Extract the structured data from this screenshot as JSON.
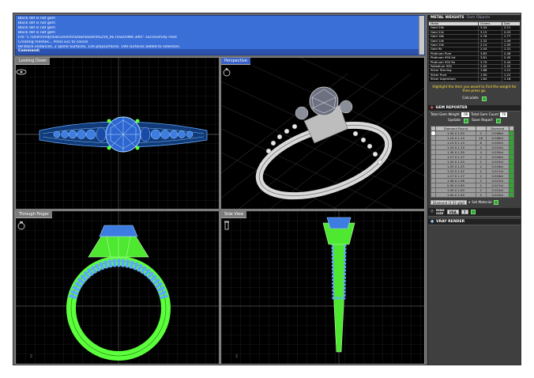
{
  "command_window": {
    "lines": [
      "Block def is not gem",
      "Block def is not gem",
      "Block def is not gem",
      "Block def is not gem",
      "File \"C:\\Users\\mdjr\\Documents\\Downloads\\RS254_RETSSD1989.3dm\" successfully read",
      "Creating meshes... Press Esc to cancel",
      "69 block instances, 2 spline Surfaces, 126 polysurfaces. 190 surfaces added to selection."
    ],
    "prompt": "Command:"
  },
  "viewports": {
    "top": "Looking Down",
    "perspective": "Perspective",
    "front": "Through Finger",
    "side": "Side View"
  },
  "metal_weights": {
    "title": "METAL WEIGHTS",
    "tab2": "Gem Objects",
    "headers": [
      "Metal",
      "Grams",
      "Dwt"
    ],
    "rows": [
      [
        "Gold 24k",
        "3.44",
        "2.21"
      ],
      [
        "Gold 22k",
        "3.15",
        "2.03"
      ],
      [
        "Gold 18k",
        "2.76",
        "1.77"
      ],
      [
        "Gold 14k",
        "2.32",
        "1.49"
      ],
      [
        "Gold 10k",
        "2.10",
        "1.35"
      ],
      [
        "Gold 9k",
        "2.04",
        "1.31"
      ],
      [
        "Platinum Pure",
        "3.83",
        "2.46"
      ],
      [
        "Platinum 950 Ird",
        "3.81",
        "2.45"
      ],
      [
        "Platinum 950 Ru",
        "3.79",
        "2.44"
      ],
      [
        "Palladium 950",
        "2.05",
        "1.32"
      ],
      [
        "Silver Sterling",
        "1.88",
        "1.21"
      ],
      [
        "Silver Pure",
        "1.90",
        "1.22"
      ],
      [
        "Silver Argentium",
        "1.84",
        "1.18"
      ]
    ],
    "hint": "Highlight the item you would to find the weight for then press go.",
    "calculate_label": "Calculate"
  },
  "gem_reporter": {
    "title": "GEM REPORTER",
    "total_weight_label": "Total Gem Weight",
    "total_weight_value": ".00",
    "total_count_label": "Total Gem Count",
    "total_count_value": "70",
    "update_label": "Update",
    "save_report_label": "Save Report",
    "headers": [
      "Diamond Round",
      "",
      "Diamond"
    ],
    "rows": [
      [
        "1.00 X 1.00",
        "2",
        "0.008ct"
      ],
      [
        "1.10 X 1.10",
        "16",
        "0.006ct"
      ],
      [
        "1.13 X 1.13",
        "6",
        "0.020ct"
      ],
      [
        "1.19 X 1.19",
        "4",
        "0.010ct"
      ],
      [
        "1.30 X 1.30",
        "4",
        "0.030ct"
      ],
      [
        "1.17 X 1.17",
        "2",
        "0.018ct"
      ],
      [
        "1.20 X 1.20",
        "2",
        "0.015ct"
      ],
      [
        "1.25 X 1.25",
        "2",
        "0.016ct"
      ],
      [
        "1.22 X 1.22",
        "2",
        "0.017ct"
      ],
      [
        "1.17 X 1.17",
        "2",
        "0.016ct"
      ],
      [
        "1.08 X 1.08",
        "2",
        "0.013ct"
      ],
      [
        "0.95 X 0.95",
        "2",
        "0.017ct"
      ],
      [
        "1.00 X 1.00",
        "2",
        "0.015ct"
      ],
      [
        "1.00 X 1.00",
        "2",
        "0.015ct"
      ]
    ],
    "diamond_select": "Diamond (3.52 g/gl)",
    "set_material_label": "Set Material"
  },
  "ring_size": {
    "label_ring": "RING",
    "label_size": "SIZE",
    "system": "USA",
    "size": "7"
  },
  "vray": {
    "title": "VRAY RENDER"
  },
  "colors": {
    "command_bg": "#3b6fd8",
    "wire_blue": "#5fa8ff",
    "wire_green": "#5cff3c",
    "panel_bg": "#3f3f3f"
  }
}
